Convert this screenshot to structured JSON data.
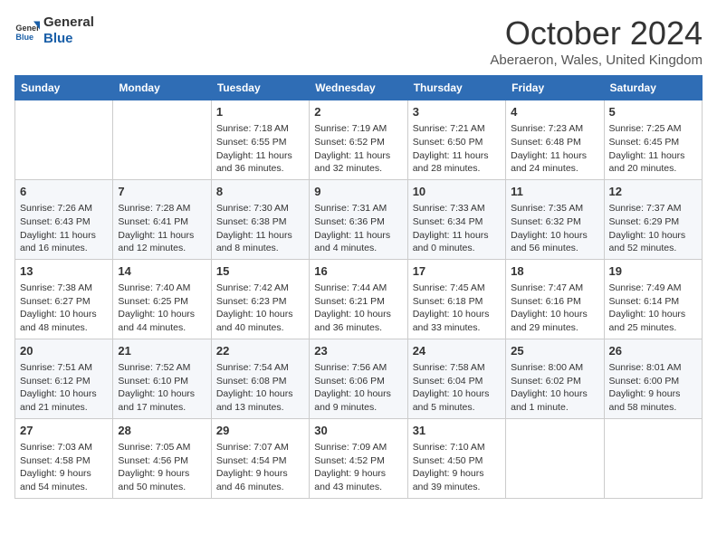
{
  "header": {
    "logo_general": "General",
    "logo_blue": "Blue",
    "month": "October 2024",
    "location": "Aberaeron, Wales, United Kingdom"
  },
  "days_of_week": [
    "Sunday",
    "Monday",
    "Tuesday",
    "Wednesday",
    "Thursday",
    "Friday",
    "Saturday"
  ],
  "weeks": [
    [
      {
        "day": "",
        "info": ""
      },
      {
        "day": "",
        "info": ""
      },
      {
        "day": "1",
        "info": "Sunrise: 7:18 AM\nSunset: 6:55 PM\nDaylight: 11 hours and 36 minutes."
      },
      {
        "day": "2",
        "info": "Sunrise: 7:19 AM\nSunset: 6:52 PM\nDaylight: 11 hours and 32 minutes."
      },
      {
        "day": "3",
        "info": "Sunrise: 7:21 AM\nSunset: 6:50 PM\nDaylight: 11 hours and 28 minutes."
      },
      {
        "day": "4",
        "info": "Sunrise: 7:23 AM\nSunset: 6:48 PM\nDaylight: 11 hours and 24 minutes."
      },
      {
        "day": "5",
        "info": "Sunrise: 7:25 AM\nSunset: 6:45 PM\nDaylight: 11 hours and 20 minutes."
      }
    ],
    [
      {
        "day": "6",
        "info": "Sunrise: 7:26 AM\nSunset: 6:43 PM\nDaylight: 11 hours and 16 minutes."
      },
      {
        "day": "7",
        "info": "Sunrise: 7:28 AM\nSunset: 6:41 PM\nDaylight: 11 hours and 12 minutes."
      },
      {
        "day": "8",
        "info": "Sunrise: 7:30 AM\nSunset: 6:38 PM\nDaylight: 11 hours and 8 minutes."
      },
      {
        "day": "9",
        "info": "Sunrise: 7:31 AM\nSunset: 6:36 PM\nDaylight: 11 hours and 4 minutes."
      },
      {
        "day": "10",
        "info": "Sunrise: 7:33 AM\nSunset: 6:34 PM\nDaylight: 11 hours and 0 minutes."
      },
      {
        "day": "11",
        "info": "Sunrise: 7:35 AM\nSunset: 6:32 PM\nDaylight: 10 hours and 56 minutes."
      },
      {
        "day": "12",
        "info": "Sunrise: 7:37 AM\nSunset: 6:29 PM\nDaylight: 10 hours and 52 minutes."
      }
    ],
    [
      {
        "day": "13",
        "info": "Sunrise: 7:38 AM\nSunset: 6:27 PM\nDaylight: 10 hours and 48 minutes."
      },
      {
        "day": "14",
        "info": "Sunrise: 7:40 AM\nSunset: 6:25 PM\nDaylight: 10 hours and 44 minutes."
      },
      {
        "day": "15",
        "info": "Sunrise: 7:42 AM\nSunset: 6:23 PM\nDaylight: 10 hours and 40 minutes."
      },
      {
        "day": "16",
        "info": "Sunrise: 7:44 AM\nSunset: 6:21 PM\nDaylight: 10 hours and 36 minutes."
      },
      {
        "day": "17",
        "info": "Sunrise: 7:45 AM\nSunset: 6:18 PM\nDaylight: 10 hours and 33 minutes."
      },
      {
        "day": "18",
        "info": "Sunrise: 7:47 AM\nSunset: 6:16 PM\nDaylight: 10 hours and 29 minutes."
      },
      {
        "day": "19",
        "info": "Sunrise: 7:49 AM\nSunset: 6:14 PM\nDaylight: 10 hours and 25 minutes."
      }
    ],
    [
      {
        "day": "20",
        "info": "Sunrise: 7:51 AM\nSunset: 6:12 PM\nDaylight: 10 hours and 21 minutes."
      },
      {
        "day": "21",
        "info": "Sunrise: 7:52 AM\nSunset: 6:10 PM\nDaylight: 10 hours and 17 minutes."
      },
      {
        "day": "22",
        "info": "Sunrise: 7:54 AM\nSunset: 6:08 PM\nDaylight: 10 hours and 13 minutes."
      },
      {
        "day": "23",
        "info": "Sunrise: 7:56 AM\nSunset: 6:06 PM\nDaylight: 10 hours and 9 minutes."
      },
      {
        "day": "24",
        "info": "Sunrise: 7:58 AM\nSunset: 6:04 PM\nDaylight: 10 hours and 5 minutes."
      },
      {
        "day": "25",
        "info": "Sunrise: 8:00 AM\nSunset: 6:02 PM\nDaylight: 10 hours and 1 minute."
      },
      {
        "day": "26",
        "info": "Sunrise: 8:01 AM\nSunset: 6:00 PM\nDaylight: 9 hours and 58 minutes."
      }
    ],
    [
      {
        "day": "27",
        "info": "Sunrise: 7:03 AM\nSunset: 4:58 PM\nDaylight: 9 hours and 54 minutes."
      },
      {
        "day": "28",
        "info": "Sunrise: 7:05 AM\nSunset: 4:56 PM\nDaylight: 9 hours and 50 minutes."
      },
      {
        "day": "29",
        "info": "Sunrise: 7:07 AM\nSunset: 4:54 PM\nDaylight: 9 hours and 46 minutes."
      },
      {
        "day": "30",
        "info": "Sunrise: 7:09 AM\nSunset: 4:52 PM\nDaylight: 9 hours and 43 minutes."
      },
      {
        "day": "31",
        "info": "Sunrise: 7:10 AM\nSunset: 4:50 PM\nDaylight: 9 hours and 39 minutes."
      },
      {
        "day": "",
        "info": ""
      },
      {
        "day": "",
        "info": ""
      }
    ]
  ]
}
